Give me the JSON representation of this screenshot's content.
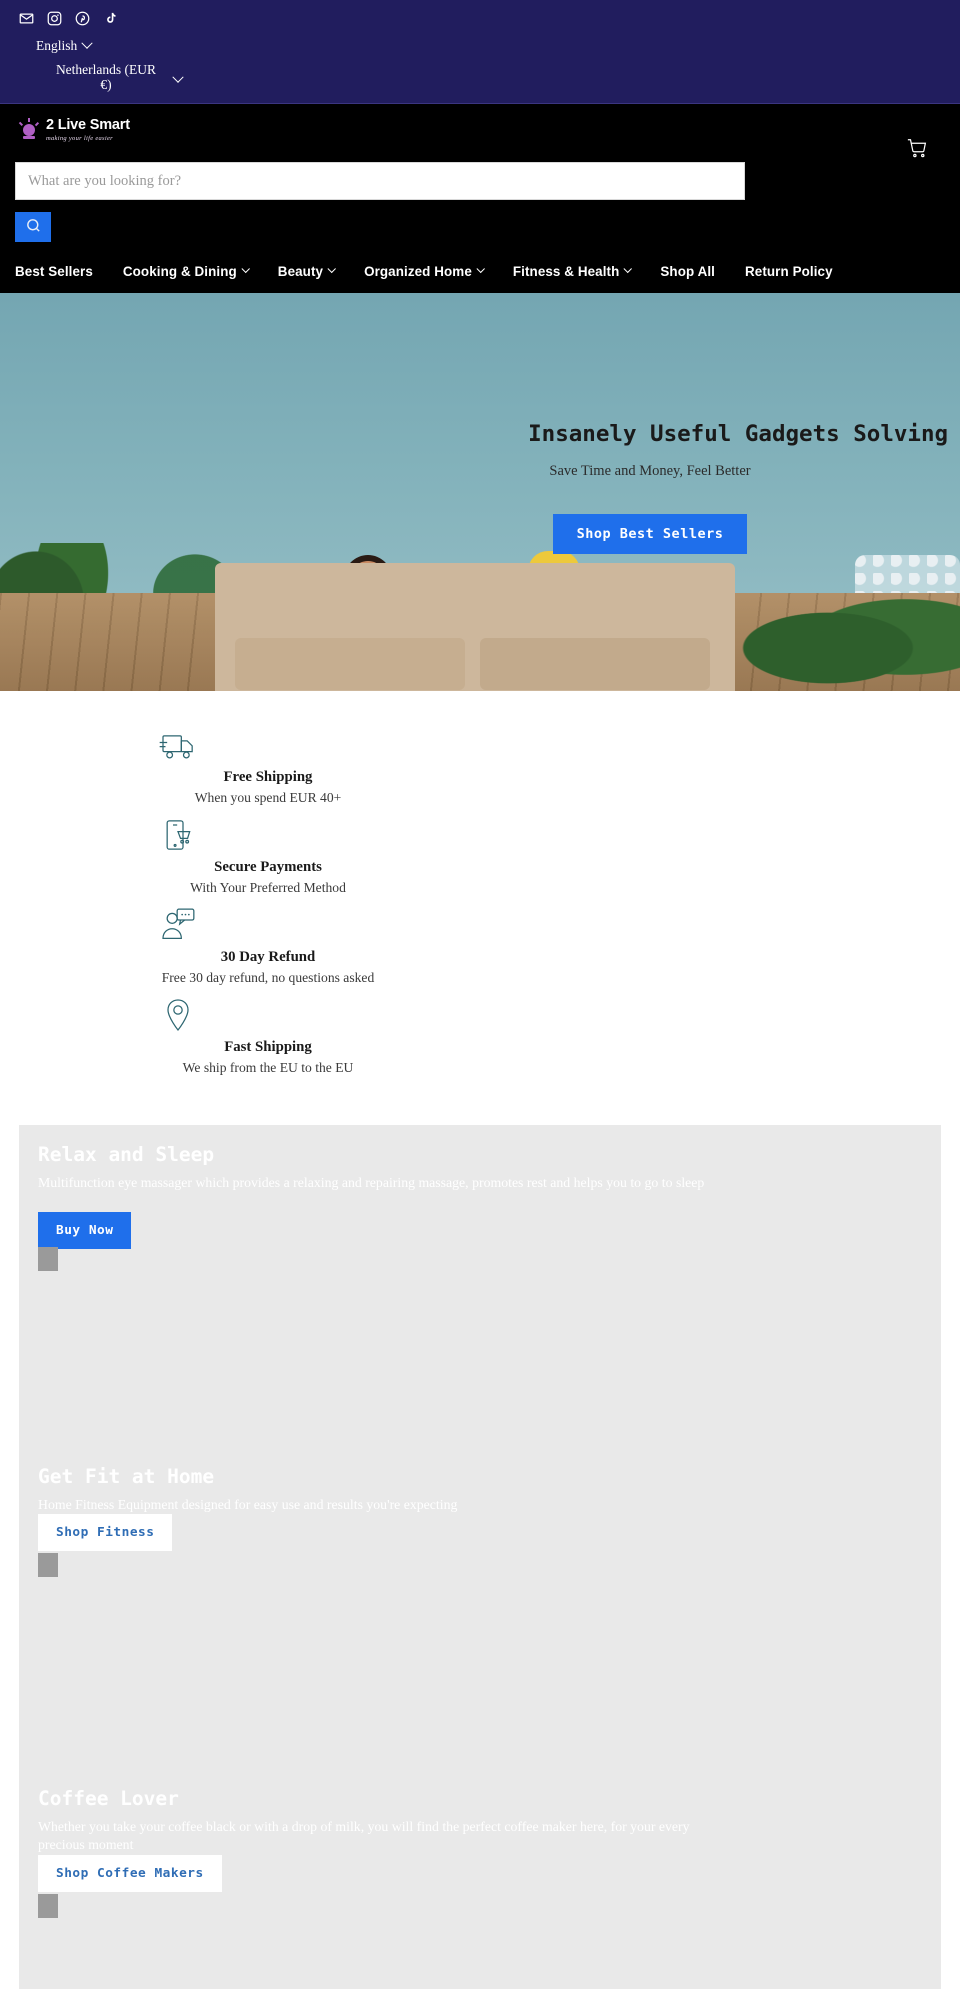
{
  "topbar": {
    "social": [
      {
        "name": "email-icon",
        "label": "Email"
      },
      {
        "name": "instagram-icon",
        "label": "Instagram"
      },
      {
        "name": "pinterest-icon",
        "label": "Pinterest"
      },
      {
        "name": "tiktok-icon",
        "label": "TikTok"
      }
    ],
    "language": "English",
    "country": "Netherlands (EUR €)",
    "bg_color": "#211d5e"
  },
  "header": {
    "logo_name": "2 Live Smart",
    "logo_tagline": "making your life easier",
    "search_placeholder": "What are you looking for?",
    "search_value": "",
    "cart_label": "Cart",
    "accent_color": "#1f6feb",
    "bg_color": "#000000"
  },
  "nav": {
    "items": [
      {
        "label": "Best Sellers",
        "has_dropdown": false
      },
      {
        "label": "Cooking & Dining",
        "has_dropdown": true
      },
      {
        "label": "Beauty",
        "has_dropdown": true
      },
      {
        "label": "Organized Home",
        "has_dropdown": true
      },
      {
        "label": "Fitness & Health",
        "has_dropdown": true
      },
      {
        "label": "Shop All",
        "has_dropdown": false
      },
      {
        "label": "Return Policy",
        "has_dropdown": false
      }
    ]
  },
  "hero": {
    "title": "Insanely Useful Gadgets Solving Everyday Problems",
    "subtitle": "Save Time and Money, Feel Better",
    "button": "Shop Best Sellers"
  },
  "features": [
    {
      "icon": "truck-icon",
      "title": "Free Shipping",
      "desc": "When you spend EUR 40+"
    },
    {
      "icon": "mobile-cart-icon",
      "title": "Secure Payments",
      "desc": "With Your Preferred Method"
    },
    {
      "icon": "person-chat-icon",
      "title": "30 Day Refund",
      "desc": "Free 30 day refund, no questions asked"
    },
    {
      "icon": "map-pin-icon",
      "title": "Fast Shipping",
      "desc": "We ship from the EU to the EU"
    }
  ],
  "promos": [
    {
      "title": "Relax and Sleep",
      "desc": "Multifunction eye massager which provides a relaxing and repairing massage, promotes rest and helps you to go to sleep",
      "button": "Buy Now",
      "button_style": "blue"
    },
    {
      "title": "Get Fit at Home",
      "desc": "Home Fitness Equipment designed for easy use and results you're expecting",
      "button": "Shop Fitness",
      "button_style": "white"
    },
    {
      "title": "Coffee Lover",
      "desc": "Whether you take your coffee black or with a drop of milk, you will find the perfect coffee maker here, for your every precious moment",
      "button": "Shop Coffee Makers",
      "button_style": "white"
    }
  ]
}
